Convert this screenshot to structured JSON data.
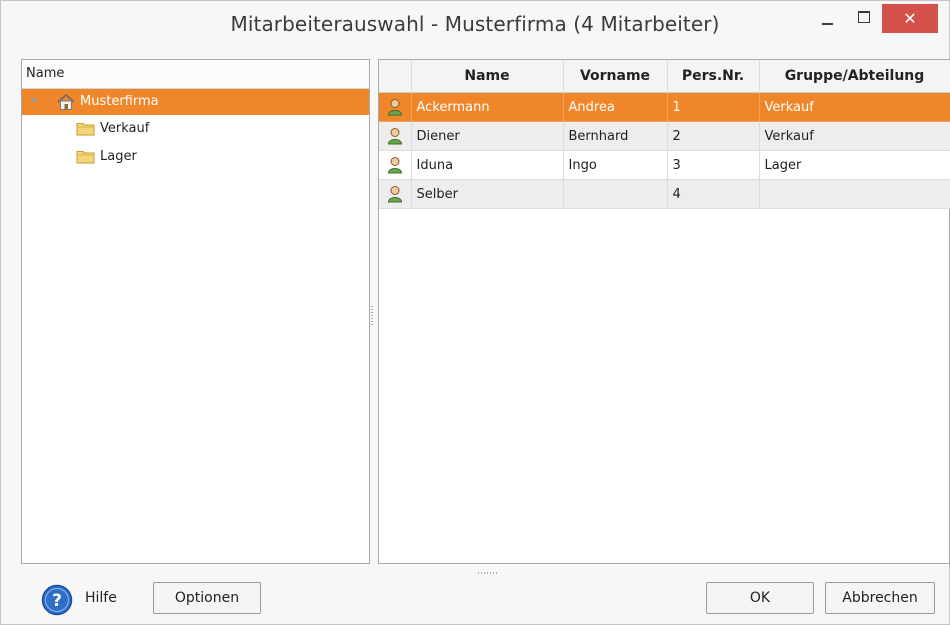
{
  "window": {
    "title": "Mitarbeiterauswahl - Musterfirma (4 Mitarbeiter)",
    "close_glyph": "✕"
  },
  "tree": {
    "header": "Name",
    "root": {
      "label": "Musterfirma",
      "icon": "house-icon"
    },
    "children": [
      {
        "label": "Verkauf",
        "icon": "folder-icon"
      },
      {
        "label": "Lager",
        "icon": "folder-icon"
      }
    ]
  },
  "grid": {
    "columns": [
      "Name",
      "Vorname",
      "Pers.Nr.",
      "Gruppe/Abteilung"
    ],
    "rows": [
      {
        "name": "Ackermann",
        "vorname": "Andrea",
        "persnr": "1",
        "gruppe": "Verkauf",
        "selected": true
      },
      {
        "name": "Diener",
        "vorname": "Bernhard",
        "persnr": "2",
        "gruppe": "Verkauf"
      },
      {
        "name": "Iduna",
        "vorname": "Ingo",
        "persnr": "3",
        "gruppe": "Lager"
      },
      {
        "name": "Selber",
        "vorname": "",
        "persnr": "4",
        "gruppe": ""
      }
    ]
  },
  "footer": {
    "help_label": "Hilfe",
    "options_label": "Optionen",
    "ok_label": "OK",
    "cancel_label": "Abbrechen"
  },
  "colors": {
    "selection": "#f0862a",
    "close_button": "#d4504a"
  }
}
